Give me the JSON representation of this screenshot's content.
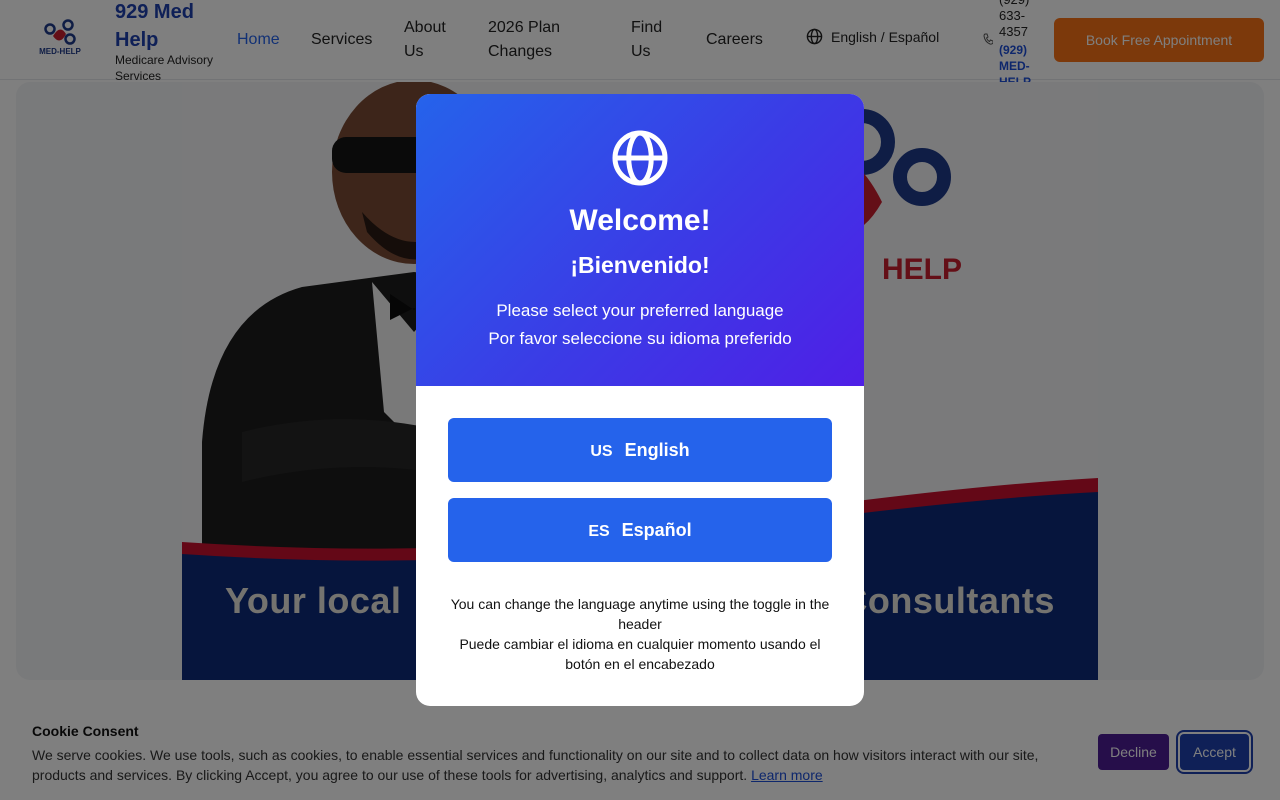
{
  "header": {
    "brand_name": "929 Med Help",
    "brand_sub": "Medicare Advisory Services",
    "logo_text": "MED-HELP",
    "nav": [
      {
        "label": "Home",
        "active": true
      },
      {
        "label": "Services"
      },
      {
        "label": "About Us"
      },
      {
        "label": "2026 Plan Changes"
      },
      {
        "label": "Find Us"
      },
      {
        "label": "Careers"
      }
    ],
    "language_toggle": "English / Español",
    "phone": "(929) 633-4357",
    "phone_alt": "(929) MED-HELP",
    "book_button": "Book Free Appointment"
  },
  "hero": {
    "logo_text": "HELP",
    "tagline_left": "Your local",
    "tagline_right": "Consultants"
  },
  "modal": {
    "title": "Welcome!",
    "title_es": "¡Bienvenido!",
    "subtitle_en": "Please select your preferred language",
    "subtitle_es": "Por favor seleccione su idioma preferido",
    "options": [
      {
        "code": "US",
        "label": "English"
      },
      {
        "code": "ES",
        "label": "Español"
      }
    ],
    "note_en": "You can change the language anytime using the toggle in the header",
    "note_es": "Puede cambiar el idioma en cualquier momento usando el botón en el encabezado"
  },
  "cookie": {
    "title": "Cookie Consent",
    "text": "We serve cookies. We use tools, such as cookies, to enable essential services and functionality on our site and to collect data on how visitors interact with our site, products and services. By clicking Accept, you agree to our use of these tools for advertising, analytics and support.",
    "learn_more": "Learn more",
    "decline": "Decline",
    "accept": "Accept"
  },
  "colors": {
    "primary": "#2563eb",
    "brand_blue": "#1e40af",
    "orange": "#f97316",
    "decline_purple": "#4c1d95"
  },
  "icons": [
    "globe-icon",
    "phone-icon",
    "logo-icon"
  ]
}
